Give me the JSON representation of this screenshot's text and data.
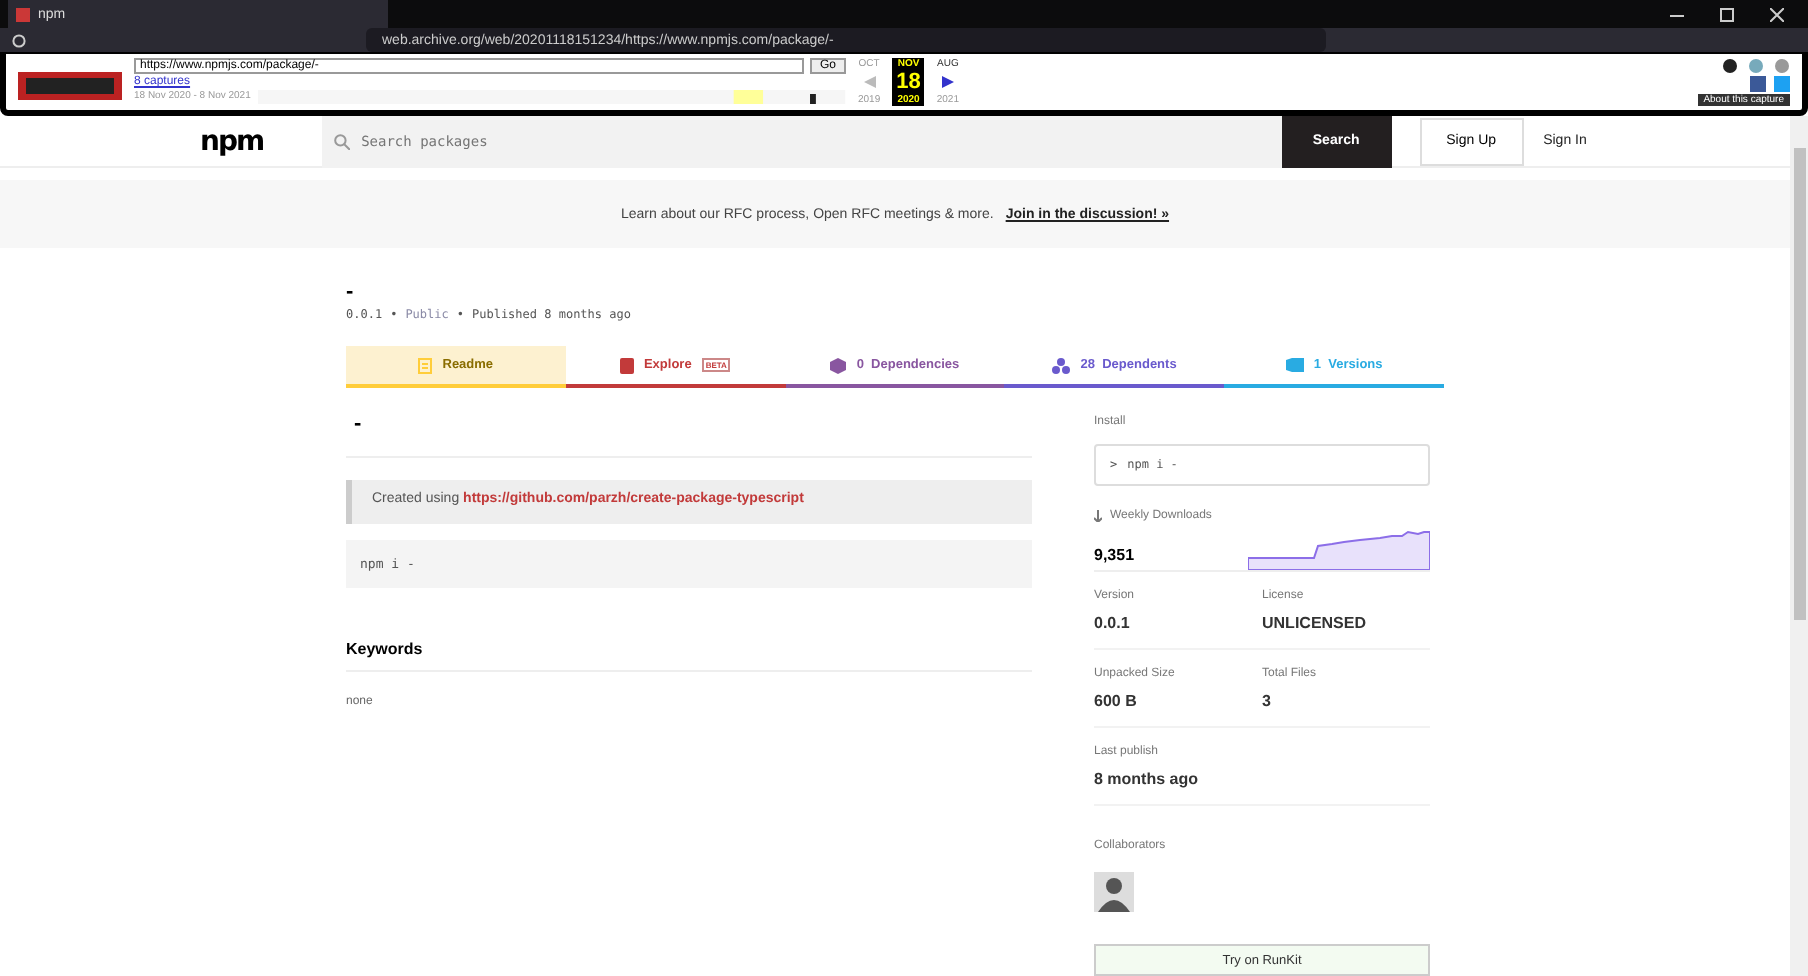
{
  "browser": {
    "tab_title": "npm",
    "address": "web.archive.org/web/20201118151234/https://www.npmjs.com/package/-"
  },
  "wayback": {
    "url": "https://www.npmjs.com/package/-",
    "go": "Go",
    "captures": "8 captures",
    "range": "18 Nov 2020 - 8 Nov 2021",
    "prev_month": "OCT",
    "month": "NOV",
    "day": "18",
    "year": "2020",
    "prev_year": "2019",
    "next_month": "AUG",
    "next_year": "2021",
    "about": "About this capture"
  },
  "header": {
    "logo": "npm",
    "search_placeholder": "Search packages",
    "search_button": "Search",
    "sign_up": "Sign Up",
    "sign_in": "Sign In"
  },
  "banner": {
    "text": "Learn about our RFC process, Open RFC meetings & more.",
    "link": "Join in the discussion! »"
  },
  "package": {
    "name": "-",
    "meta": [
      {
        "text": "0.0.1",
        "kind": "plain"
      },
      {
        "text": "•",
        "kind": "separator"
      },
      {
        "text": "Public",
        "kind": "muted"
      },
      {
        "text": "•",
        "kind": "separator"
      },
      {
        "text": "Published 8 months ago",
        "kind": "plain"
      }
    ]
  },
  "tabs": [
    {
      "label": "Readme",
      "kind": "readme",
      "selected": true,
      "color": "#ffcd3a"
    },
    {
      "label": "Explore",
      "kind": "explore",
      "badge": "BETA",
      "selected": false,
      "color": "#c23a3a"
    },
    {
      "label": "0  Dependencies",
      "kind": "deps",
      "selected": false,
      "color": "#8956a0"
    },
    {
      "label": "28  Dependents",
      "kind": "dependents",
      "selected": false,
      "color": "#6a5acd"
    },
    {
      "label": "1  Versions",
      "kind": "versions",
      "selected": false,
      "color": "#29abe2"
    }
  ],
  "readme": {
    "heading": "-",
    "quote_prefix": "Created using",
    "quote_link": "https://github.com/parzh/create-package-typescript",
    "code": "npm i -",
    "keywords_title": "Keywords",
    "keywords": "none"
  },
  "sidebar": {
    "install_label": "Install",
    "install_prompt": ">",
    "install_cmd": "npm i -",
    "downloads_label": "Weekly Downloads",
    "downloads": "9,351",
    "facts": [
      {
        "label": "Version",
        "value": "0.0.1"
      },
      {
        "label": "License",
        "value": "UNLICENSED"
      },
      {
        "label": "Unpacked Size",
        "value": "600 B"
      },
      {
        "label": "Total Files",
        "value": "3"
      },
      {
        "label": "Last publish",
        "value": "8 months ago"
      }
    ],
    "collaborators_label": "Collaborators",
    "runkit": "Try on RunKit"
  }
}
